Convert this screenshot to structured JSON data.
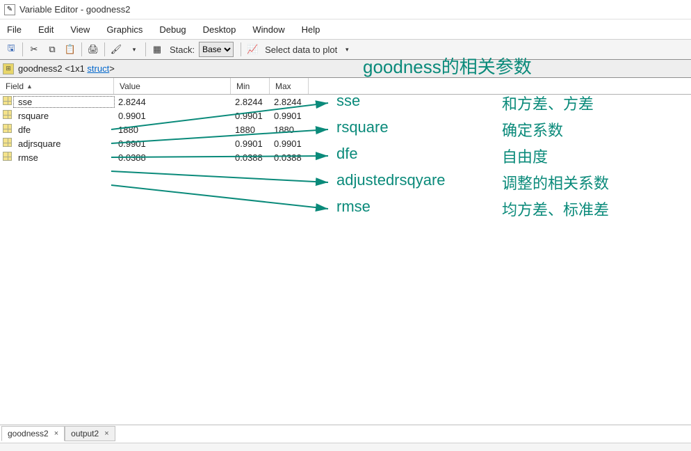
{
  "window": {
    "title": "Variable Editor - goodness2"
  },
  "menu": {
    "items": [
      "File",
      "Edit",
      "View",
      "Graphics",
      "Debug",
      "Desktop",
      "Window",
      "Help"
    ]
  },
  "toolbar": {
    "stack_label": "Stack:",
    "stack_value": "Base",
    "plot_label": "Select data to plot"
  },
  "path": {
    "var": "goodness2",
    "dims": "<1x1 ",
    "type": "struct",
    "close": ">"
  },
  "grid": {
    "headers": {
      "field": "Field",
      "value": "Value",
      "min": "Min",
      "max": "Max"
    },
    "rows": [
      {
        "field": "sse",
        "value": "2.8244",
        "min": "2.8244",
        "max": "2.8244"
      },
      {
        "field": "rsquare",
        "value": "0.9901",
        "min": "0.9901",
        "max": "0.9901"
      },
      {
        "field": "dfe",
        "value": "1880",
        "min": "1880",
        "max": "1880"
      },
      {
        "field": "adjrsquare",
        "value": "0.9901",
        "min": "0.9901",
        "max": "0.9901"
      },
      {
        "field": "rmse",
        "value": "0.0388",
        "min": "0.0388",
        "max": "0.0388"
      }
    ]
  },
  "tabs": [
    {
      "name": "goodness2",
      "active": true
    },
    {
      "name": "output2",
      "active": false
    }
  ],
  "annotations": {
    "title": "goodness的相关参数",
    "items": [
      {
        "en": "sse",
        "zh": "和方差、方差"
      },
      {
        "en": "rsquare",
        "zh": "确定系数"
      },
      {
        "en": "dfe",
        "zh": "自由度"
      },
      {
        "en": "adjustedrsqyare",
        "zh": "调整的相关系数"
      },
      {
        "en": "rmse",
        "zh": "均方差、标准差"
      }
    ]
  }
}
